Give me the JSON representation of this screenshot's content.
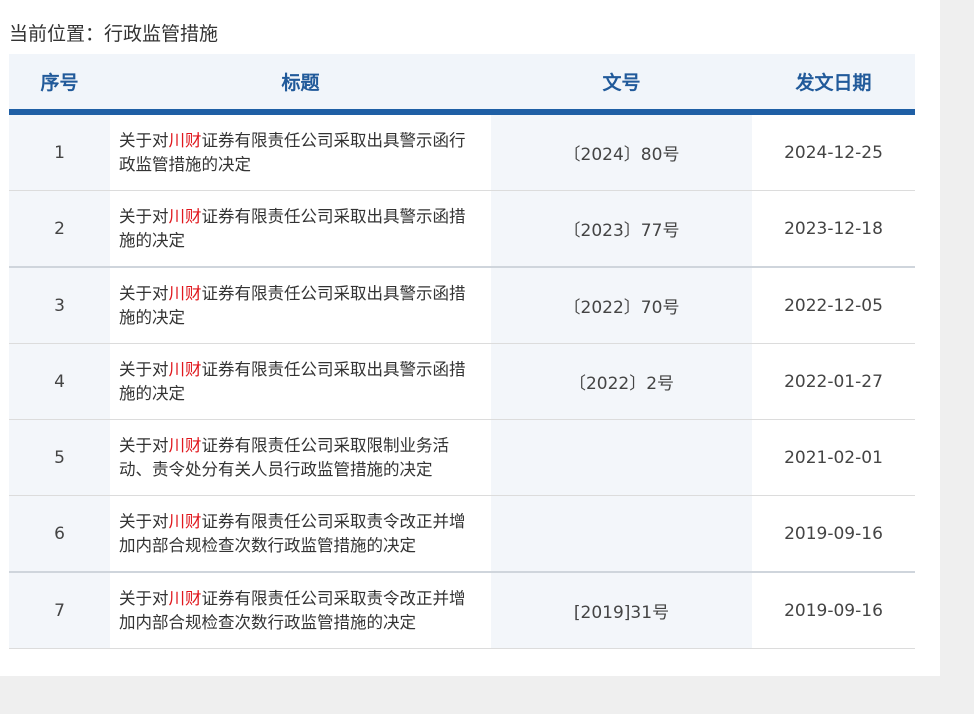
{
  "breadcrumb": {
    "label": "当前位置：",
    "current": "行政监管措施"
  },
  "table": {
    "headers": [
      "序号",
      "标题",
      "文号",
      "发文日期"
    ],
    "rows": [
      {
        "no": "1",
        "title_pre": "关于对",
        "title_hl": "川财",
        "title_post": "证券有限责任公司采取出具警示函行政监管措施的决定",
        "doc_no": "〔2024〕80号",
        "date": "2024-12-25"
      },
      {
        "no": "2",
        "title_pre": "关于对",
        "title_hl": "川财",
        "title_post": "证券有限责任公司采取出具警示函措施的决定",
        "doc_no": "〔2023〕77号",
        "date": "2023-12-18"
      },
      {
        "no": "3",
        "title_pre": "关于对",
        "title_hl": "川财",
        "title_post": "证券有限责任公司采取出具警示函措施的决定",
        "doc_no": "〔2022〕70号",
        "date": "2022-12-05"
      },
      {
        "no": "4",
        "title_pre": "关于对",
        "title_hl": "川财",
        "title_post": "证券有限责任公司采取出具警示函措施的决定",
        "doc_no": "〔2022〕2号",
        "date": "2022-01-27"
      },
      {
        "no": "5",
        "title_pre": "关于对",
        "title_hl": "川财",
        "title_post": "证券有限责任公司采取限制业务活动、责令处分有关人员行政监管措施的决定",
        "doc_no": "",
        "date": "2021-02-01"
      },
      {
        "no": "6",
        "title_pre": "关于对",
        "title_hl": "川财",
        "title_post": "证券有限责任公司采取责令改正并增加内部合规检查次数行政监管措施的决定",
        "doc_no": "",
        "date": "2019-09-16"
      },
      {
        "no": "7",
        "title_pre": "关于对",
        "title_hl": "川财",
        "title_post": "证券有限责任公司采取责令改正并增加内部合规检查次数行政监管措施的决定",
        "doc_no": "[2019]31号",
        "date": "2019-09-16"
      }
    ]
  },
  "colors": {
    "header_text": "#215a9a",
    "header_rule": "#1f5fa5",
    "highlight": "#e0161c"
  }
}
